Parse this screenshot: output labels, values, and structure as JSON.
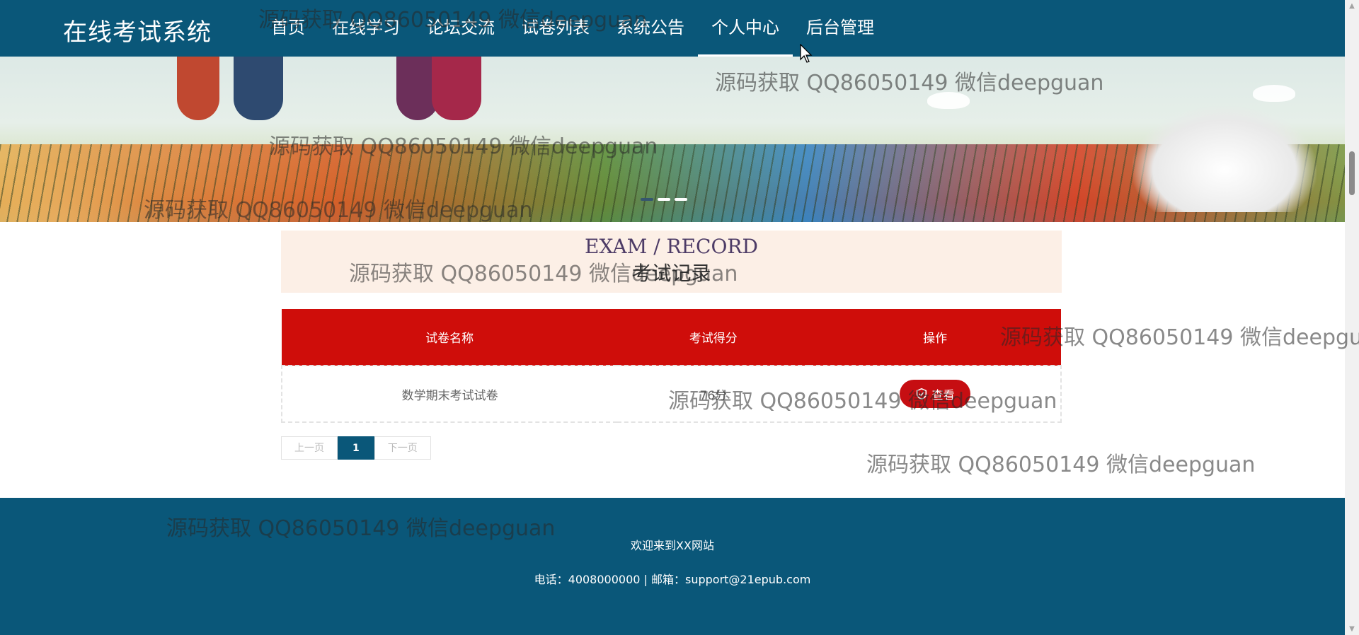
{
  "header": {
    "brand": "在线考试系统",
    "nav": [
      {
        "label": "首页"
      },
      {
        "label": "在线学习"
      },
      {
        "label": "论坛交流"
      },
      {
        "label": "试卷列表"
      },
      {
        "label": "系统公告"
      },
      {
        "label": "个人中心",
        "active": true
      },
      {
        "label": "后台管理"
      }
    ]
  },
  "section": {
    "title_en": "EXAM / RECORD",
    "title_cn": "考试记录"
  },
  "table": {
    "headers": [
      "试卷名称",
      "考试得分",
      "操作"
    ],
    "rows": [
      {
        "name": "数学期末考试试卷",
        "score": "76分",
        "action": "查看"
      }
    ]
  },
  "pagination": {
    "prev": "上一页",
    "current": "1",
    "next": "下一页"
  },
  "footer": {
    "line1": "欢迎来到XX网站",
    "line2": "电话：4008000000 | 邮箱：support@21epub.com"
  },
  "watermark": "源码获取 QQ86050149 微信deepguan",
  "colors": {
    "nav_bg": "#0a5779",
    "table_header": "#cf0d0a",
    "section_bg": "#fcefe6",
    "button": "#c60e12"
  }
}
